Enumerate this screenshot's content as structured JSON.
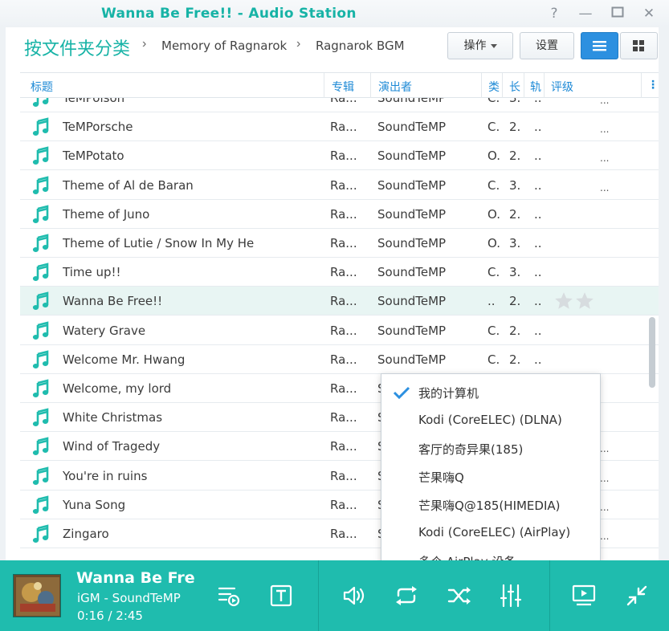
{
  "window": {
    "title": "Wanna Be Free!! - Audio Station"
  },
  "header": {
    "breadcrumb": [
      "按文件夹分类",
      "Memory of Ragnarok",
      "Ragnarok BGM"
    ],
    "action_label": "操作",
    "settings_label": "设置"
  },
  "columns": [
    "标题",
    "专辑",
    "演出者",
    "类",
    "长",
    "轨",
    "评级"
  ],
  "rows": [
    {
      "title": "TeMPoison",
      "album": "Ra...",
      "artist": "SoundTeMP",
      "type": "C.",
      "length": "3.",
      "track": "..",
      "dots": "..."
    },
    {
      "title": "TeMPorsche",
      "album": "Ra...",
      "artist": "SoundTeMP",
      "type": "C.",
      "length": "2.",
      "track": "..",
      "dots": "..."
    },
    {
      "title": "TeMPotato",
      "album": "Ra...",
      "artist": "SoundTeMP",
      "type": "O.",
      "length": "2.",
      "track": "..",
      "dots": "..."
    },
    {
      "title": "Theme of Al de Baran",
      "album": "Ra...",
      "artist": "SoundTeMP",
      "type": "C.",
      "length": "3.",
      "track": "..",
      "dots": "..."
    },
    {
      "title": "Theme of Juno",
      "album": "Ra...",
      "artist": "SoundTeMP",
      "type": "O.",
      "length": "2.",
      "track": "..",
      "dots": ""
    },
    {
      "title": "Theme of Lutie / Snow In My He",
      "album": "Ra...",
      "artist": "SoundTeMP",
      "type": "O.",
      "length": "3.",
      "track": "..",
      "dots": ""
    },
    {
      "title": "Time up!!",
      "album": "Ra...",
      "artist": "SoundTeMP",
      "type": "C.",
      "length": "3.",
      "track": "..",
      "dots": ""
    },
    {
      "title": "Wanna Be Free!!",
      "album": "Ra...",
      "artist": "SoundTeMP",
      "type": "..",
      "length": "2.",
      "track": "..",
      "dots": ""
    },
    {
      "title": "Watery Grave",
      "album": "Ra...",
      "artist": "SoundTeMP",
      "type": "C.",
      "length": "2.",
      "track": "..",
      "dots": ""
    },
    {
      "title": "Welcome Mr. Hwang",
      "album": "Ra...",
      "artist": "SoundTeMP",
      "type": "C.",
      "length": "2.",
      "track": "..",
      "dots": ""
    },
    {
      "title": "Welcome, my lord",
      "album": "Ra...",
      "artist": "S",
      "type": "",
      "length": "",
      "track": "",
      "dots": ""
    },
    {
      "title": "White Christmas",
      "album": "Ra...",
      "artist": "S",
      "type": "",
      "length": "",
      "track": "",
      "dots": ""
    },
    {
      "title": "Wind of Tragedy",
      "album": "Ra...",
      "artist": "S",
      "type": "",
      "length": "",
      "track": "",
      "dots": "..."
    },
    {
      "title": "You're in ruins",
      "album": "Ra...",
      "artist": "S",
      "type": "",
      "length": "",
      "track": "",
      "dots": "..."
    },
    {
      "title": "Yuna Song",
      "album": "Ra...",
      "artist": "S",
      "type": "",
      "length": "",
      "track": "",
      "dots": "..."
    },
    {
      "title": "Zingaro",
      "album": "Ra...",
      "artist": "S",
      "type": "",
      "length": "",
      "track": "",
      "dots": "..."
    }
  ],
  "selected_row": 7,
  "device_menu": {
    "items": [
      "我的计算机",
      "Kodi (CoreELEC) (DLNA)",
      "客厅的奇异果(185)",
      "芒果嗨Q",
      "芒果嗨Q@185(HIMEDIA)",
      "Kodi (CoreELEC) (AirPlay)",
      "多个 AirPlay 设备"
    ],
    "checked_index": 0
  },
  "player": {
    "title": "Wanna Be Fre",
    "artist_line": "iGM - SoundTeMP",
    "time": "0:16 / 2:45"
  },
  "colors": {
    "accent": "#1fbcae",
    "title_teal": "#17b3a6",
    "link_blue": "#1e8ad6",
    "primary_blue": "#2c90e0"
  }
}
